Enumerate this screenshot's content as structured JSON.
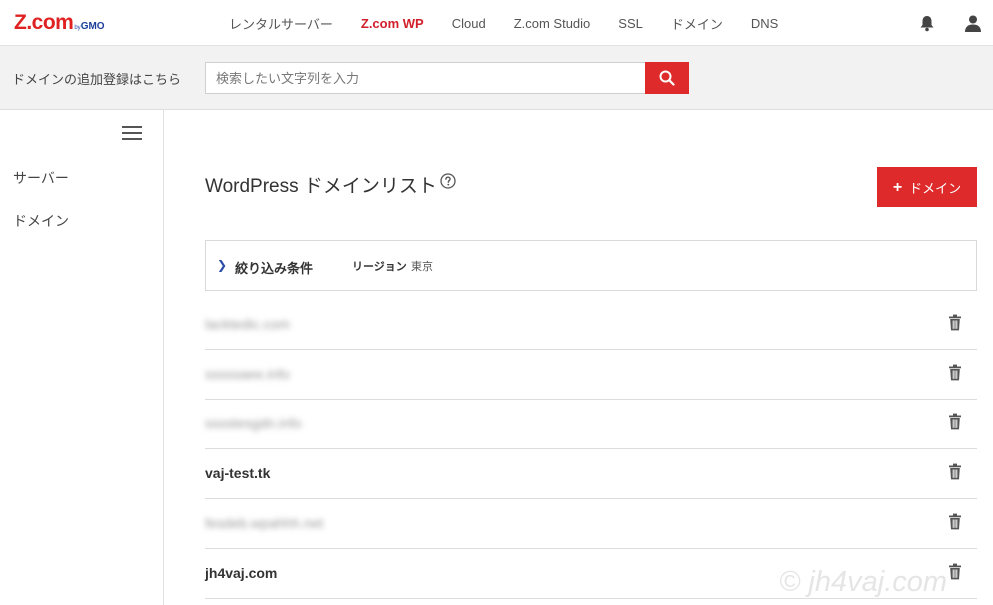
{
  "header": {
    "logo_main": "Z.com",
    "logo_by": "by",
    "logo_gmo": "GMO",
    "nav": [
      {
        "label": "レンタルサーバー",
        "active": false
      },
      {
        "label": "Z.com WP",
        "active": true
      },
      {
        "label": "Cloud",
        "active": false
      },
      {
        "label": "Z.com Studio",
        "active": false
      },
      {
        "label": "SSL",
        "active": false
      },
      {
        "label": "ドメイン",
        "active": false
      },
      {
        "label": "DNS",
        "active": false
      }
    ],
    "icons": [
      "bell-icon",
      "user-icon"
    ]
  },
  "search": {
    "label": "ドメインの追加登録はこちら",
    "placeholder": "検索したい文字列を入力",
    "button_icon": "search-icon"
  },
  "sidebar": {
    "items": [
      {
        "label": "サーバー"
      },
      {
        "label": "ドメイン"
      }
    ]
  },
  "main": {
    "title": "WordPress ドメインリスト",
    "add_button": "ドメイン",
    "filter": {
      "label": "絞り込み条件",
      "key": "リージョン",
      "value": "東京"
    },
    "domains": [
      {
        "name": "lacktedic.com",
        "blurred": true
      },
      {
        "name": "sssssaee.info",
        "blurred": true
      },
      {
        "name": "sssstesgdn.info",
        "blurred": true
      },
      {
        "name": "vaj-test.tk",
        "blurred": false
      },
      {
        "name": "fesdeb.wpahhh.net",
        "blurred": true
      },
      {
        "name": "jh4vaj.com",
        "blurred": false
      }
    ]
  },
  "watermark": "© jh4vaj.com",
  "colors": {
    "accent": "#de2a2a",
    "nav_active": "#d21f2a",
    "logo_blue": "#1d3f9a"
  }
}
